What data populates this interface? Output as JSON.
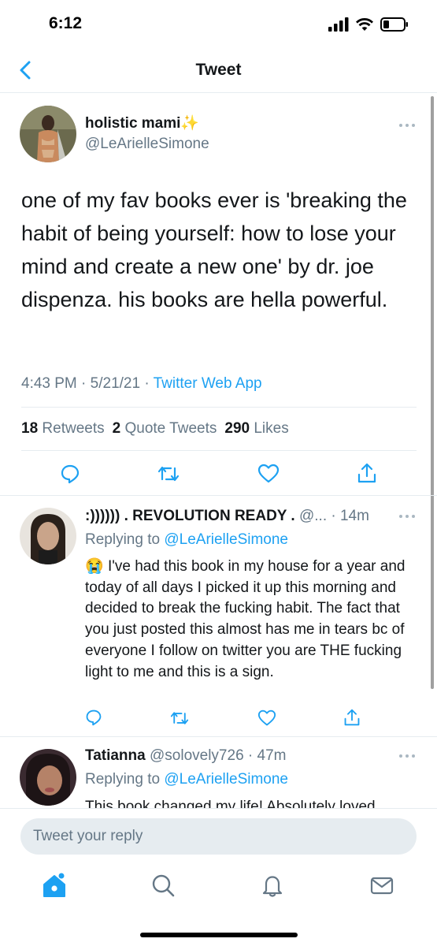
{
  "status_bar": {
    "time": "6:12"
  },
  "nav": {
    "title": "Tweet"
  },
  "main_tweet": {
    "name": "holistic mami",
    "name_emoji": "✨",
    "handle": "@LeArielleSimone",
    "text": "one of my fav books ever is 'breaking the habit of being yourself: how to lose your mind and create a new one' by dr. joe dispenza. his books are hella powerful.",
    "time": "4:43 PM",
    "date": "5/21/21",
    "source": "Twitter Web App",
    "retweets_count": "18",
    "retweets_label": "Retweets",
    "quotes_count": "2",
    "quotes_label": "Quote Tweets",
    "likes_count": "290",
    "likes_label": "Likes"
  },
  "replies": [
    {
      "name": ":)))))) . REVOLUTION READY .",
      "handle": "@...",
      "time": "14m",
      "replying_label": "Replying to",
      "replying_to": "@LeArielleSimone",
      "emoji": "😭",
      "text": "I've had this book in my house for a year and today of all days I picked it up this morning and decided to break the fucking habit. The fact that you just posted this almost has me in tears bc of everyone I follow on twitter you are THE fucking light to me and this is a sign."
    },
    {
      "name": "Tatianna",
      "handle": "@solovely726",
      "time": "47m",
      "replying_label": "Replying to",
      "replying_to": "@LeArielleSimone",
      "text": "This book changed my life! Absolutely loved"
    }
  ],
  "reply_box": {
    "placeholder": "Tweet your reply"
  },
  "colors": {
    "accent": "#1da1f2",
    "muted": "#657786",
    "text": "#14171a",
    "divider": "#e6ecf0"
  },
  "icons": [
    "back-chevron-icon",
    "signal-icon",
    "wifi-icon",
    "battery-icon",
    "more-icon",
    "reply-icon",
    "retweet-icon",
    "like-icon",
    "share-icon",
    "home-icon",
    "search-icon",
    "notifications-icon",
    "messages-icon"
  ]
}
